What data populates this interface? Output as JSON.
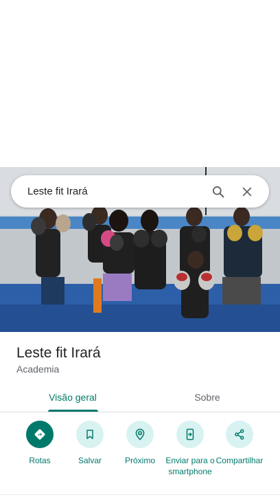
{
  "search": {
    "query": "Leste fit Irará"
  },
  "place": {
    "title": "Leste fit Irará",
    "category": "Academia"
  },
  "tabs": [
    {
      "label": "Visão geral",
      "active": true
    },
    {
      "label": "Sobre",
      "active": false
    }
  ],
  "actions": [
    {
      "label": "Rotas",
      "icon": "directions-icon"
    },
    {
      "label": "Salvar",
      "icon": "bookmark-icon"
    },
    {
      "label": "Próximo",
      "icon": "nearby-icon"
    },
    {
      "label": "Enviar para o smartphone",
      "icon": "send-to-phone-icon"
    },
    {
      "label": "Compartilhar",
      "icon": "share-icon"
    }
  ],
  "colors": {
    "accent": "#00796b",
    "action_bg": "#d8f2f1",
    "text_primary": "#202124",
    "text_secondary": "#5f6368"
  }
}
